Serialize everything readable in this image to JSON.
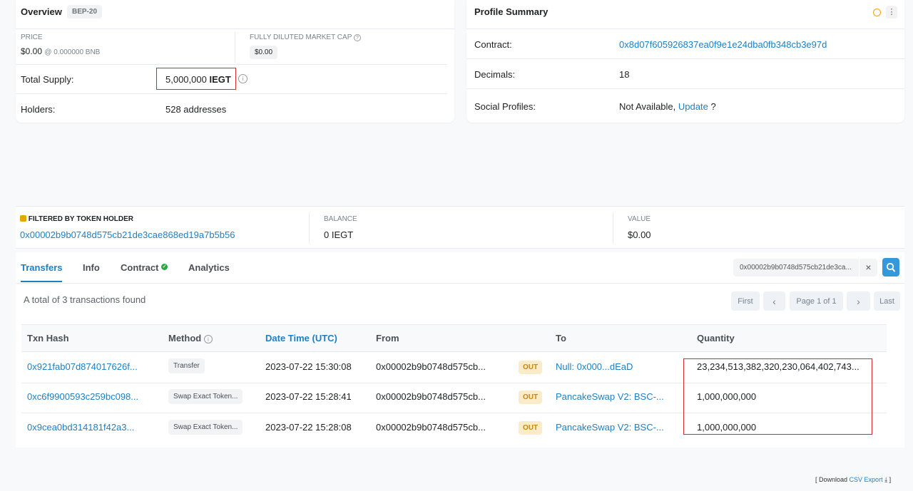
{
  "overview": {
    "title": "Overview",
    "standard_badge": "BEP-20",
    "price_label": "PRICE",
    "price_value": "$0.00",
    "price_bnb": "@ 0.000000 BNB",
    "fdmc_label": "FULLY DILUTED MARKET CAP",
    "fdmc_value": "$0.00",
    "total_supply_label": "Total Supply:",
    "total_supply_amount": "5,000,000",
    "total_supply_symbol": "IEGT",
    "holders_label": "Holders:",
    "holders_value": "528 addresses"
  },
  "profile": {
    "title": "Profile Summary",
    "contract_label": "Contract:",
    "contract_value": "0x8d07f605926837ea0f9e1e24dba0fb348cb3e97d",
    "decimals_label": "Decimals:",
    "decimals_value": "18",
    "social_label": "Social Profiles:",
    "social_value": "Not Available,",
    "social_update": "Update",
    "social_q": "?"
  },
  "filter": {
    "label": "FILTERED BY TOKEN HOLDER",
    "address": "0x00002b9b0748d575cb21de3cae868ed19a7b5b56",
    "balance_label": "BALANCE",
    "balance_value": "0 IEGT",
    "value_label": "VALUE",
    "value_value": "$0.00"
  },
  "tabs": {
    "transfers": "Transfers",
    "info": "Info",
    "contract": "Contract",
    "analytics": "Analytics"
  },
  "search": {
    "value": "0x00002b9b0748d575cb21de3ca...",
    "clear": "×"
  },
  "summary": "A total of 3 transactions found",
  "pagination": {
    "first": "First",
    "prev": "‹",
    "page": "Page 1 of 1",
    "next": "›",
    "last": "Last"
  },
  "table": {
    "headers": {
      "txn_hash": "Txn Hash",
      "method": "Method",
      "date_time": "Date Time (UTC)",
      "from": "From",
      "to": "To",
      "quantity": "Quantity"
    },
    "rows": [
      {
        "hash": "0x921fab07d874017626f...",
        "method": "Transfer",
        "date": "2023-07-22 15:30:08",
        "from": "0x00002b9b0748d575cb...",
        "dir": "OUT",
        "to": "Null: 0x000...dEaD",
        "qty": "23,234,513,382,320,230,064,402,743..."
      },
      {
        "hash": "0xc6f9900593c259bc098...",
        "method": "Swap Exact Token...",
        "date": "2023-07-22 15:28:41",
        "from": "0x00002b9b0748d575cb...",
        "dir": "OUT",
        "to": "PancakeSwap V2: BSC-...",
        "qty": "1,000,000,000"
      },
      {
        "hash": "0x9cea0bd314181f42a3...",
        "method": "Swap Exact Token...",
        "date": "2023-07-22 15:28:08",
        "from": "0x00002b9b0748d575cb...",
        "dir": "OUT",
        "to": "PancakeSwap V2: BSC-...",
        "qty": "1,000,000,000"
      }
    ]
  },
  "footer": {
    "open": "[ Download",
    "csv": "CSV Export",
    "close": "]"
  },
  "colors": {
    "link": "#1e7fc4",
    "highlight_box": "#d9272e",
    "out_badge": "#fbecc9",
    "search_button": "#3498db"
  }
}
